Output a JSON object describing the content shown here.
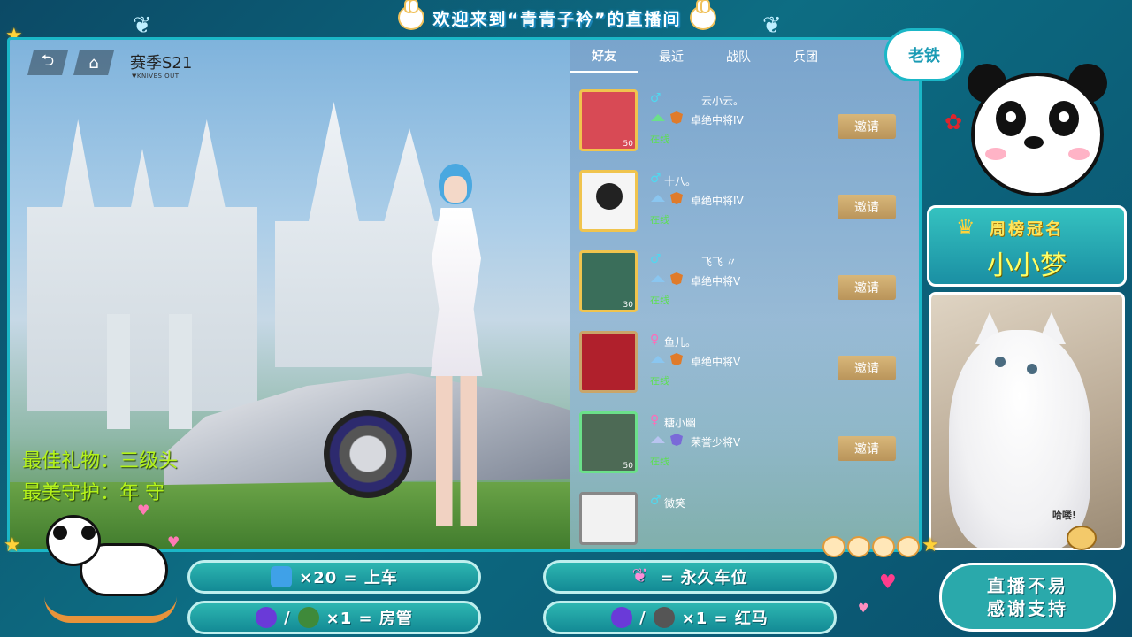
{
  "banner": {
    "text": "欢迎来到“青青子衿”的直播间"
  },
  "game": {
    "season_title": "赛季S21",
    "season_sub": "▼KNIVES OUT",
    "tabs": [
      {
        "label": "好友",
        "active": true
      },
      {
        "label": "最近",
        "active": false
      },
      {
        "label": "战队",
        "active": false
      },
      {
        "label": "兵团",
        "active": false
      }
    ],
    "friends": [
      {
        "gender": "♂",
        "gender_type": "male",
        "name": "云小云。",
        "rank": "卓绝中将IV",
        "status": "在线",
        "level": "50",
        "invite": "邀请",
        "avatar_color": "#d84a55"
      },
      {
        "gender": "♂",
        "gender_type": "male",
        "name": "十八。",
        "rank": "卓绝中将IV",
        "status": "在线",
        "level": "",
        "invite": "邀请",
        "avatar_color": "#f5f5f5"
      },
      {
        "gender": "♂",
        "gender_type": "male",
        "name": "飞飞 〃",
        "rank": "卓绝中将V",
        "status": "在线",
        "level": "30",
        "invite": "邀请",
        "avatar_color": "#3a6e5a"
      },
      {
        "gender": "♀",
        "gender_type": "female",
        "name": "鱼儿。",
        "rank": "卓绝中将V",
        "status": "在线",
        "level": "",
        "invite": "邀请",
        "avatar_color": "#b0202c"
      },
      {
        "gender": "♀",
        "gender_type": "female",
        "name": "糖小幽",
        "rank": "荣誉少将V",
        "status": "在线",
        "level": "50",
        "invite": "邀请",
        "avatar_color": "#4d6a55"
      },
      {
        "gender": "♂",
        "gender_type": "male",
        "name": "微笑",
        "rank": "",
        "status": "",
        "level": "",
        "invite": "",
        "avatar_color": "#f2f2f2"
      }
    ],
    "overlay": {
      "best_gift": "最佳礼物：三级头",
      "best_guard": "最美守护：年   守"
    }
  },
  "right": {
    "laotie": "老铁",
    "weekly_rank_title": "周榜冠名",
    "weekly_rank_name": "小小梦",
    "haha": "哈喽!"
  },
  "bottom": {
    "gift1": "×20 = 上车",
    "gift2": "= 永久车位",
    "gift3_sep": "/",
    "gift3": "×1 = 房管",
    "gift4_sep": "/",
    "gift4": "×1 = 红马",
    "thanks_line1": "直播不易",
    "thanks_line2": "感谢支持"
  },
  "colors": {
    "accent": "#1bb7c7",
    "overlay_text": "#b5f31a",
    "online": "#5de052",
    "invite": "#c9a56a",
    "male": "#4fd9f0",
    "female": "#ff6bb8"
  }
}
